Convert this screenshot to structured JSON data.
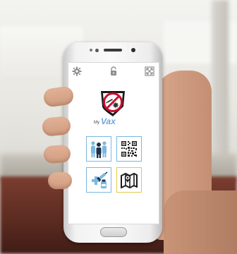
{
  "app": {
    "name_prefix": "My",
    "name": "Vax"
  },
  "toolbar": {
    "icons": [
      "gear-icon",
      "unlock-icon",
      "expand-icon"
    ]
  },
  "tiles": [
    {
      "icon": "family-icon",
      "border_color": "#7bb8e0"
    },
    {
      "icon": "qr-code-icon",
      "border_color": "#7bb8e0"
    },
    {
      "icon": "vaccine-icon",
      "border_color": "#7bb8e0"
    },
    {
      "icon": "map-icon",
      "border_color": "#e6c84a"
    }
  ],
  "colors": {
    "accent_blue": "#6fa8d8",
    "logo_red": "#c8102e"
  }
}
